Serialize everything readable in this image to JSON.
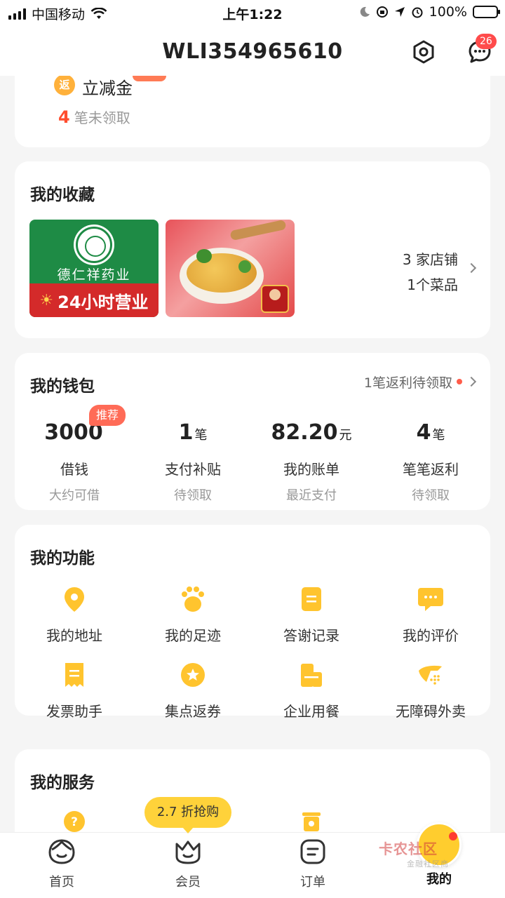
{
  "status_bar": {
    "carrier": "中国移动",
    "time": "上午1:22",
    "battery": "100%"
  },
  "nav": {
    "title": "WLI354965610",
    "message_count": "26"
  },
  "rebate": {
    "icon_char": "返",
    "name": "立减金",
    "count": "4",
    "count_suffix": "笔未领取"
  },
  "favorites": {
    "title": "我的收藏",
    "store_brand": "德仁祥药业",
    "store_banner": "24小时营业",
    "stores_text": "3 家店铺",
    "dishes_text": "1个菜品"
  },
  "wallet": {
    "title": "我的钱包",
    "link_text": "1笔返利待领取",
    "recommend_badge": "推荐",
    "items": [
      {
        "value": "3000",
        "unit": "",
        "label": "借钱",
        "sub": "大约可借"
      },
      {
        "value": "1",
        "unit": "笔",
        "label": "支付补贴",
        "sub": "待领取"
      },
      {
        "value": "82.20",
        "unit": "元",
        "label": "我的账单",
        "sub": "最近支付"
      },
      {
        "value": "4",
        "unit": "笔",
        "label": "笔笔返利",
        "sub": "待领取"
      }
    ]
  },
  "functions": {
    "title": "我的功能",
    "items": [
      {
        "label": "我的地址",
        "icon": "location-pin-icon"
      },
      {
        "label": "我的足迹",
        "icon": "paw-icon"
      },
      {
        "label": "答谢记录",
        "icon": "document-icon"
      },
      {
        "label": "我的评价",
        "icon": "chat-bubble-icon"
      },
      {
        "label": "发票助手",
        "icon": "receipt-icon"
      },
      {
        "label": "集点返券",
        "icon": "star-coin-icon"
      },
      {
        "label": "企业用餐",
        "icon": "building-icon"
      },
      {
        "label": "无障碍外卖",
        "icon": "accessibility-icon"
      }
    ]
  },
  "services": {
    "title": "我的服务",
    "promo": "2.7 折抢购"
  },
  "tabs": [
    {
      "label": "首页"
    },
    {
      "label": "会员"
    },
    {
      "label": "订单"
    },
    {
      "label": "我的"
    }
  ],
  "watermark": {
    "text": "卡农社区",
    "sub": "金融社区商"
  },
  "colors": {
    "accent": "#ffc42e",
    "alert": "#ff4d2e",
    "background": "#f5f5f5"
  }
}
